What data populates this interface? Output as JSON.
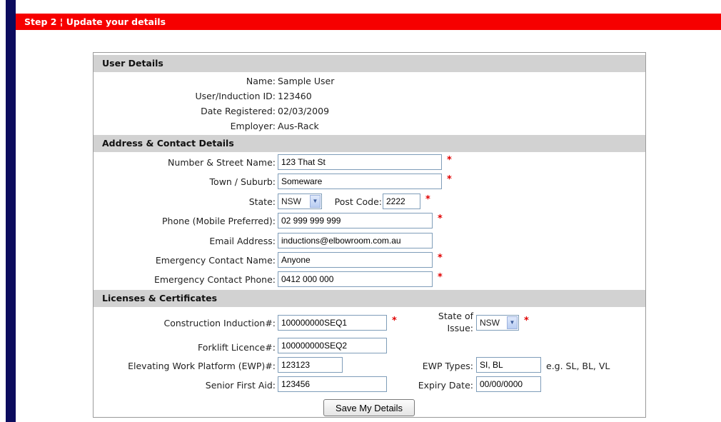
{
  "header": {
    "title": "Step 2 ¦ Update your details"
  },
  "sections": {
    "user": "User Details",
    "address": "Address & Contact Details",
    "licenses": "Licenses & Certificates"
  },
  "user_details": {
    "name_label": "Name:",
    "name": "Sample User",
    "id_label": "User/Induction ID:",
    "id": "123460",
    "date_label": "Date Registered:",
    "date": "02/03/2009",
    "employer_label": "Employer:",
    "employer": "Aus-Rack"
  },
  "address": {
    "street_label": "Number & Street Name:",
    "street": "123 That St",
    "town_label": "Town / Suburb:",
    "town": "Someware",
    "state_label": "State:",
    "state": "NSW",
    "postcode_label": "Post Code:",
    "postcode": "2222",
    "phone_label": "Phone (Mobile Preferred):",
    "phone": "02 999 999 999",
    "email_label": "Email Address:",
    "email": "inductions@elbowroom.com.au",
    "emergency_name_label": "Emergency Contact Name:",
    "emergency_name": "Anyone",
    "emergency_phone_label": "Emergency Contact Phone:",
    "emergency_phone": "0412 000 000"
  },
  "licenses": {
    "construction_label": "Construction Induction#:",
    "construction": "100000000SEQ1",
    "state_issue_label_1": "State of",
    "state_issue_label_2": "Issue:",
    "state_issue": "NSW",
    "forklift_label": "Forklift Licence#:",
    "forklift": "100000000SEQ2",
    "ewp_label": "Elevating Work Platform (EWP)#:",
    "ewp": "123123",
    "ewp_types_label": "EWP Types:",
    "ewp_types": "SI, BL",
    "ewp_hint": "e.g. SL, BL, VL",
    "first_aid_label": "Senior First Aid:",
    "first_aid": "123456",
    "expiry_label": "Expiry Date:",
    "expiry": "00/00/0000"
  },
  "required_marker": "*",
  "select_arrow": "▼",
  "actions": {
    "save_label": "Save My Details"
  }
}
